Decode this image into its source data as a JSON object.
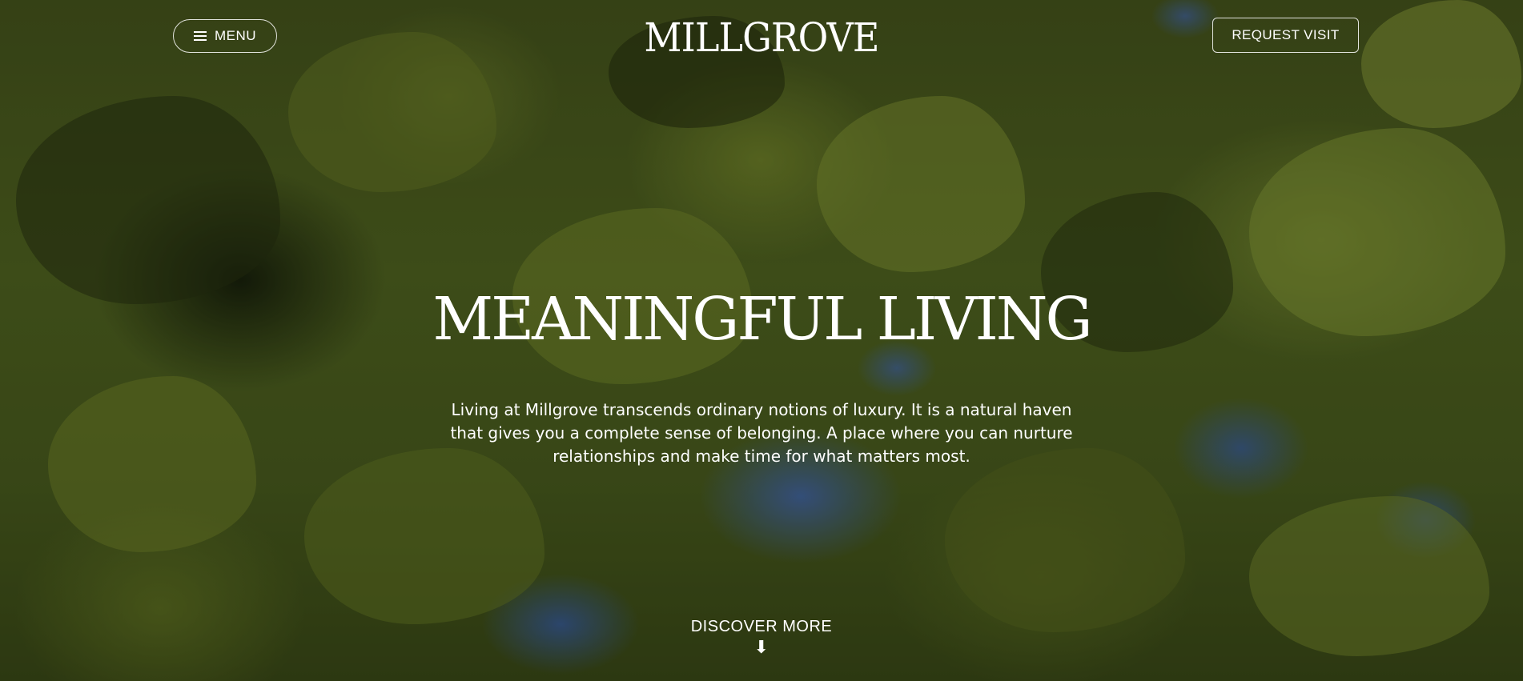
{
  "header": {
    "menu_label": "MENU",
    "menu_icon": "hamburger-icon",
    "logo_text": "MILLGROVE",
    "request_visit_label": "REQUEST VISIT"
  },
  "hero": {
    "headline": "MEANINGFUL LIVING",
    "intro": "Living at Millgrove transcends ordinary notions of luxury. It is a natural haven that gives you a complete sense of belonging. A place where you can nurture relationships and make time for what matters most.",
    "discover_label": "DISCOVER MORE",
    "discover_icon": "arrow-down-icon",
    "discover_arrow": "⬇"
  },
  "colors": {
    "text": "#ffffff",
    "foliage": "#556a22",
    "sky": "#466ebe"
  }
}
